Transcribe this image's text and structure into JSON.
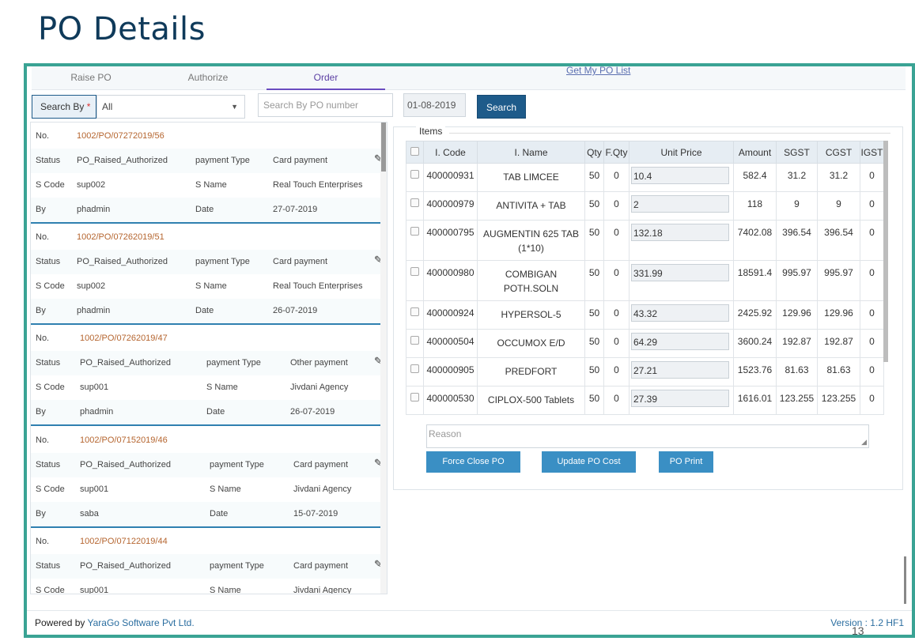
{
  "page_title": "PO Details",
  "tabs": [
    {
      "label": "Raise PO"
    },
    {
      "label": "Authorize"
    },
    {
      "label": "Order"
    }
  ],
  "topbar_link": "Get My PO List",
  "search": {
    "search_by_label": "Search By",
    "required_mark": "*",
    "select_value": "All",
    "po_placeholder": "Search By PO number",
    "date_value": "01-08-2019",
    "button": "Search"
  },
  "po_cards": [
    {
      "no_label": "No.",
      "no": "1002/PO/07272019/56",
      "status_label": "Status",
      "status": "PO_Raised_Authorized",
      "pt_label": "payment Type",
      "payment_type": "Card payment",
      "scode_label": "S Code",
      "scode": "sup002",
      "sname_label": "S Name",
      "sname": "Real Touch Enterprises",
      "by_label": "By",
      "by": "phadmin",
      "date_label": "Date",
      "date": "27-07-2019"
    },
    {
      "no_label": "No.",
      "no": "1002/PO/07262019/51",
      "status_label": "Status",
      "status": "PO_Raised_Authorized",
      "pt_label": "payment Type",
      "payment_type": "Card payment",
      "scode_label": "S Code",
      "scode": "sup002",
      "sname_label": "S Name",
      "sname": "Real Touch Enterprises",
      "by_label": "By",
      "by": "phadmin",
      "date_label": "Date",
      "date": "26-07-2019"
    },
    {
      "no_label": "No.",
      "no": "1002/PO/07262019/47",
      "status_label": "Status",
      "status": "PO_Raised_Authorized",
      "pt_label": "payment Type",
      "payment_type": "Other payment",
      "scode_label": "S Code",
      "scode": "sup001",
      "sname_label": "S Name",
      "sname": "Jivdani Agency",
      "by_label": "By",
      "by": "phadmin",
      "date_label": "Date",
      "date": "26-07-2019"
    },
    {
      "no_label": "No.",
      "no": "1002/PO/07152019/46",
      "status_label": "Status",
      "status": "PO_Raised_Authorized",
      "pt_label": "payment Type",
      "payment_type": "Card payment",
      "scode_label": "S Code",
      "scode": "sup001",
      "sname_label": "S Name",
      "sname": "Jivdani Agency",
      "by_label": "By",
      "by": "saba",
      "date_label": "Date",
      "date": "15-07-2019"
    },
    {
      "no_label": "No.",
      "no": "1002/PO/07122019/44",
      "status_label": "Status",
      "status": "PO_Raised_Authorized",
      "pt_label": "payment Type",
      "payment_type": "Card payment",
      "scode_label": "S Code",
      "scode": "sup001",
      "sname_label": "S Name",
      "sname": "Jivdani Agency",
      "by_label": "",
      "by": "",
      "date_label": "",
      "date": ""
    }
  ],
  "items": {
    "label": "Items",
    "headers": [
      "I. Code",
      "I. Name",
      "Qty",
      "F.Qty",
      "Unit Price",
      "Amount",
      "SGST",
      "CGST",
      "IGST"
    ],
    "rows": [
      {
        "code": "400000931",
        "name": "TAB LIMCEE",
        "qty": "50",
        "fqty": "0",
        "price": "10.4",
        "amount": "582.4",
        "sgst": "31.2",
        "cgst": "31.2",
        "igst": "0"
      },
      {
        "code": "400000979",
        "name": "ANTIVITA + TAB",
        "qty": "50",
        "fqty": "0",
        "price": "2",
        "amount": "118",
        "sgst": "9",
        "cgst": "9",
        "igst": "0"
      },
      {
        "code": "400000795",
        "name": "AUGMENTIN 625 TAB (1*10)",
        "qty": "50",
        "fqty": "0",
        "price": "132.18",
        "amount": "7402.08",
        "sgst": "396.54",
        "cgst": "396.54",
        "igst": "0"
      },
      {
        "code": "400000980",
        "name": "COMBIGAN POTH.SOLN",
        "qty": "50",
        "fqty": "0",
        "price": "331.99",
        "amount": "18591.4",
        "sgst": "995.97",
        "cgst": "995.97",
        "igst": "0"
      },
      {
        "code": "400000924",
        "name": "HYPERSOL-5",
        "qty": "50",
        "fqty": "0",
        "price": "43.32",
        "amount": "2425.92",
        "sgst": "129.96",
        "cgst": "129.96",
        "igst": "0"
      },
      {
        "code": "400000504",
        "name": "OCCUMOX E/D",
        "qty": "50",
        "fqty": "0",
        "price": "64.29",
        "amount": "3600.24",
        "sgst": "192.87",
        "cgst": "192.87",
        "igst": "0"
      },
      {
        "code": "400000905",
        "name": "PREDFORT",
        "qty": "50",
        "fqty": "0",
        "price": "27.21",
        "amount": "1523.76",
        "sgst": "81.63",
        "cgst": "81.63",
        "igst": "0"
      },
      {
        "code": "400000530",
        "name": "CIPLOX-500 Tablets",
        "qty": "50",
        "fqty": "0",
        "price": "27.39",
        "amount": "1616.01",
        "sgst": "123.255",
        "cgst": "123.255",
        "igst": "0"
      }
    ]
  },
  "reason_placeholder": "Reason",
  "actions": {
    "force_close": "Force Close PO",
    "update_cost": "Update PO Cost",
    "print": "PO Print"
  },
  "footer": {
    "powered_by": "Powered by",
    "company": "YaraGo Software Pvt Ltd.",
    "version": "Version : 1.2 HF1"
  },
  "slide_number": "13",
  "colors": {
    "frame": "#3aa394",
    "primary": "#1e5b8a",
    "action": "#3a8fc4",
    "po_number": "#b5652f"
  }
}
